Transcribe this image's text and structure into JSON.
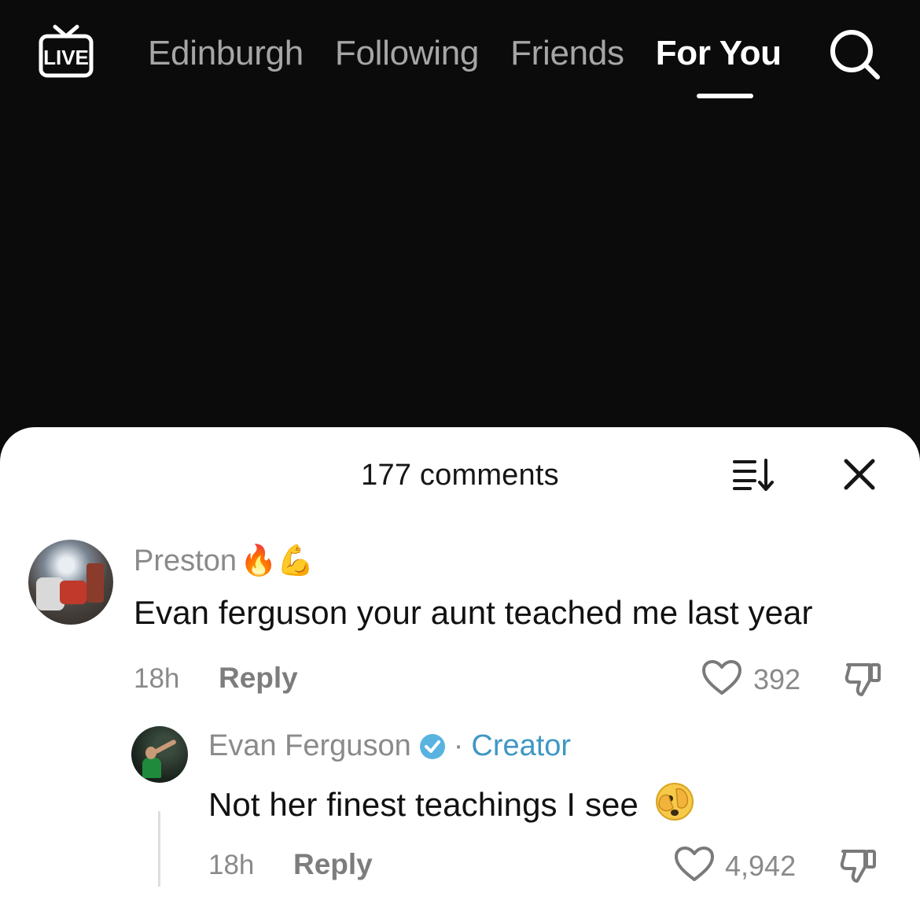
{
  "topbar": {
    "live_label": "LIVE",
    "tabs": [
      {
        "label": "Edinburgh",
        "active": false
      },
      {
        "label": "Following",
        "active": false
      },
      {
        "label": "Friends",
        "active": false
      },
      {
        "label": "For You",
        "active": true
      }
    ]
  },
  "comments_sheet": {
    "title": "177 comments",
    "comments": [
      {
        "username": "Preston",
        "username_emoji": "🔥💪",
        "text": "Evan ferguson your aunt teached me last year",
        "time": "18h",
        "reply_label": "Reply",
        "likes": "392"
      },
      {
        "username": "Evan Ferguson",
        "verified": true,
        "separator": "·",
        "creator_label": "Creator",
        "text": "Not her finest teachings I see",
        "time": "18h",
        "reply_label": "Reply",
        "likes": "4,942"
      }
    ]
  },
  "colors": {
    "background": "#0b0b0b",
    "sheet": "#ffffff",
    "creator": "#3f97c4",
    "verified": "#59b3e0"
  },
  "icons": [
    "live-tv-icon",
    "search-icon",
    "sort-icon",
    "close-icon",
    "heart-icon",
    "thumbs-down-icon",
    "verified-badge-icon",
    "face-with-hand-over-eye-emoji"
  ]
}
